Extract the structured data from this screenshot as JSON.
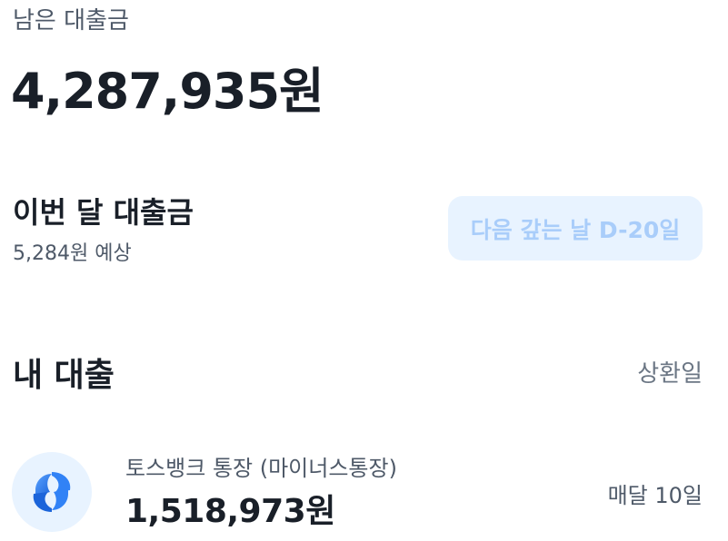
{
  "summary": {
    "remaining_label": "남은 대출금",
    "remaining_amount": "4,287,935원"
  },
  "this_month": {
    "title": "이번 달 대출금",
    "expected": "5,284원 예상",
    "dday_button": "다음 갚는 날 D-20일"
  },
  "my_loans": {
    "title": "내 대출",
    "sort_label": "상환일",
    "items": [
      {
        "icon": "toss-bank-logo-icon",
        "name": "토스뱅크 통장 (마이너스통장)",
        "amount": "1,518,973원",
        "due": "매달 10일"
      }
    ]
  },
  "colors": {
    "accent": "#3182f6",
    "button_bg": "#e8f3ff",
    "button_text": "#a9cdfa",
    "text_primary": "#191f28",
    "text_secondary": "#4e5968"
  }
}
